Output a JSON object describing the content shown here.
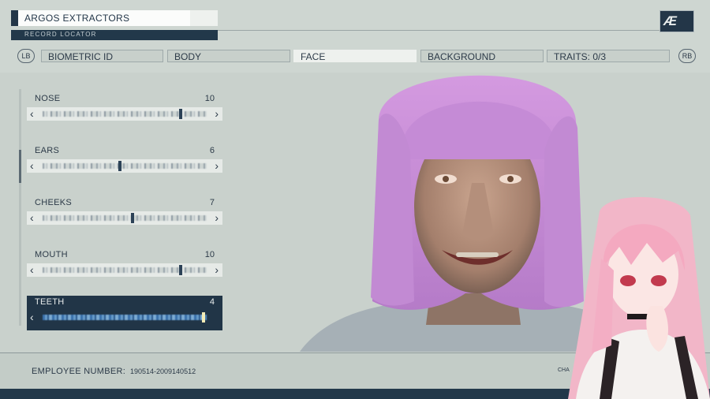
{
  "header": {
    "name": "ARGOS EXTRACTORS",
    "record_locator": "RECORD LOCATOR",
    "logo_text": "Æ"
  },
  "tabs": {
    "left_bumper": "LB",
    "right_bumper": "RB",
    "items": [
      {
        "label": "BIOMETRIC ID",
        "active": false
      },
      {
        "label": "BODY",
        "active": false
      },
      {
        "label": "FACE",
        "active": true
      },
      {
        "label": "BACKGROUND",
        "active": false
      },
      {
        "label": "TRAITS: 0/3",
        "active": false
      }
    ]
  },
  "sliders": [
    {
      "label": "NOSE",
      "value": "10",
      "level": 0.85
    },
    {
      "label": "EARS",
      "value": "6",
      "level": 0.47
    },
    {
      "label": "CHEEKS",
      "value": "7",
      "level": 0.55
    },
    {
      "label": "MOUTH",
      "value": "10",
      "level": 0.85
    },
    {
      "label": "TEETH",
      "value": "4",
      "level": 0.99,
      "selected": true
    }
  ],
  "arrows": {
    "left": "‹",
    "right": "›"
  },
  "footer": {
    "employee_label": "EMPLOYEE NUMBER:",
    "employee_value": "190514-2009140512",
    "cha_text": "CHA"
  },
  "colors": {
    "navy": "#213547",
    "panel": "#c9d1cc",
    "hair": "#c98ed8",
    "overlay_hair": "#f2b6c8"
  }
}
